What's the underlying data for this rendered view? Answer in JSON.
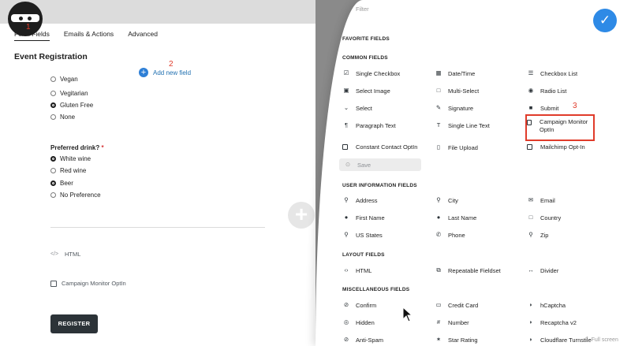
{
  "tabs": [
    {
      "label": "Form Fields",
      "num": "1"
    },
    {
      "label": "Emails & Actions"
    },
    {
      "label": "Advanced"
    }
  ],
  "form": {
    "title": "Event Registration",
    "add_field": "Add new field",
    "add_num": "2",
    "diet_options": [
      {
        "label": "Vegan",
        "checked": false
      },
      {
        "label": "Vegitarian",
        "checked": false
      },
      {
        "label": "Gluten Free",
        "checked": true
      },
      {
        "label": "None",
        "checked": false
      }
    ],
    "drink_label": "Preferred drink?",
    "drink_required": "*",
    "drink_options": [
      {
        "label": "White wine",
        "checked": true
      },
      {
        "label": "Red wine",
        "checked": false
      },
      {
        "label": "Beer",
        "checked": true
      },
      {
        "label": "No Preference",
        "checked": false
      }
    ],
    "html_code_icon": "</>",
    "html_label": "HTML",
    "optin_label": "Campaign Monitor OptIn",
    "register_label": "REGISTER"
  },
  "panel": {
    "filter_placeholder": "Filter",
    "highlight_num": "3",
    "fullscreen_label": "Full screen",
    "sections": {
      "favorite": "FAVORITE FIELDS",
      "common": "COMMON FIELDS",
      "user": "USER INFORMATION FIELDS",
      "layout": "LAYOUT FIELDS",
      "misc": "MISCELLANEOUS FIELDS"
    },
    "common": {
      "single_checkbox": "Single Checkbox",
      "datetime": "Date/Time",
      "checkbox_list": "Checkbox List",
      "select_image": "Select Image",
      "multi_select": "Multi-Select",
      "radio_list": "Radio List",
      "select": "Select",
      "signature": "Signature",
      "submit": "Submit",
      "paragraph_text": "Paragraph Text",
      "single_line_text": "Single Line Text",
      "campaign_monitor": "Campaign Monitor OptIn",
      "constant_contact": "Constant Contact OptIn",
      "file_upload": "File Upload",
      "mailchimp": "Mailchimp Opt-In",
      "save": "Save"
    },
    "user": {
      "address": "Address",
      "city": "City",
      "email": "Email",
      "first_name": "First Name",
      "last_name": "Last Name",
      "country": "Country",
      "us_states": "US States",
      "phone": "Phone",
      "zip": "Zip"
    },
    "layout": {
      "html": "HTML",
      "repeatable": "Repeatable Fieldset",
      "divider": "Divider"
    },
    "misc": {
      "confirm": "Confirm",
      "credit_card": "Credit Card",
      "hcaptcha": "hCaptcha",
      "hidden": "Hidden",
      "number": "Number",
      "recaptcha": "Recaptcha v2",
      "anti_spam": "Anti-Spam",
      "star_rating": "Star Rating",
      "cloudflare": "Cloudflare Turnstile"
    }
  }
}
